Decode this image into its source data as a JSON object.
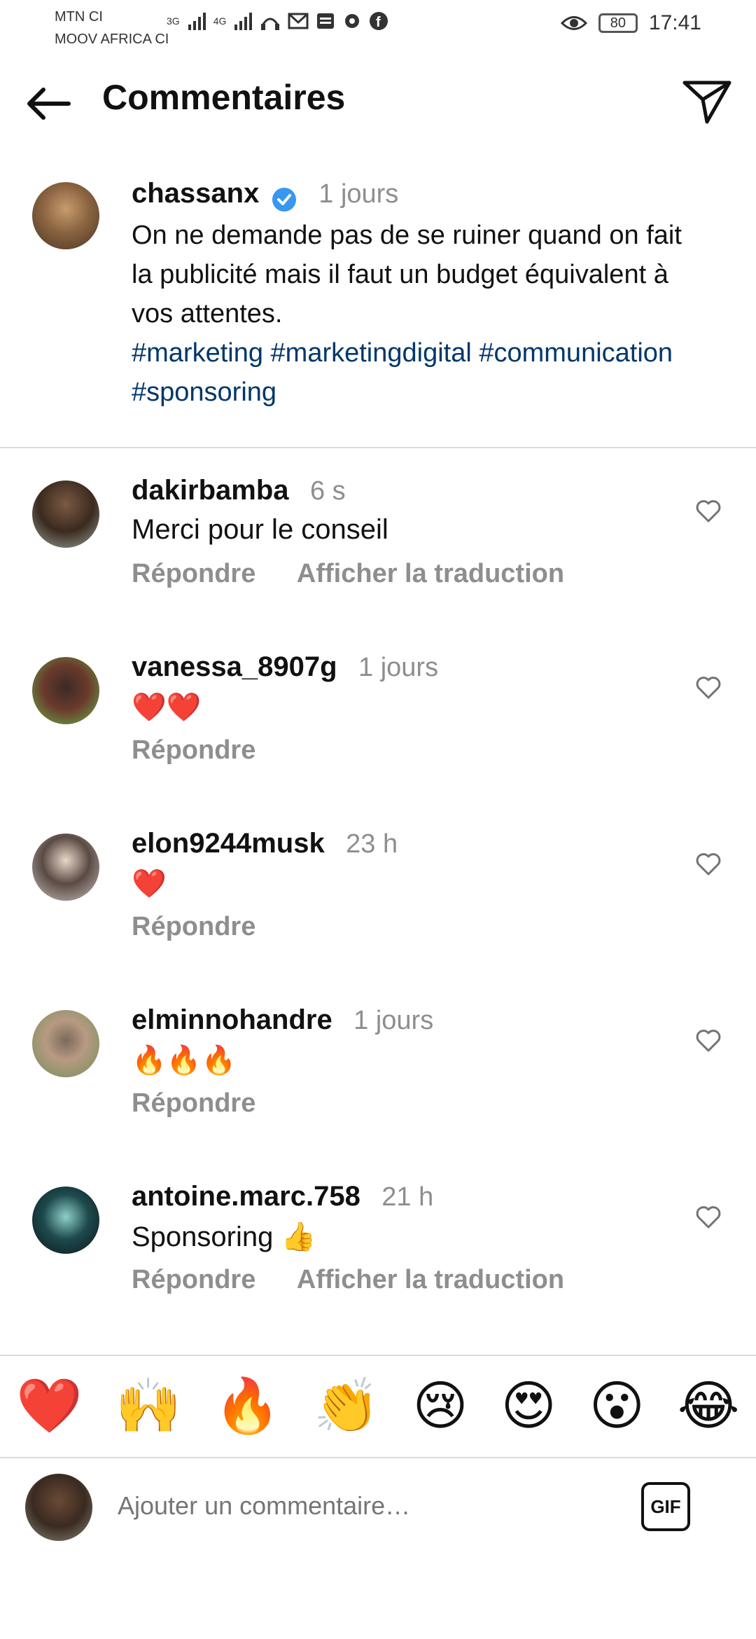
{
  "status_bar": {
    "carrier1": "MTN CI",
    "carrier2": "MOOV AFRICA CI",
    "network1": "3G",
    "network2": "4G",
    "battery": "80",
    "time": "17:41"
  },
  "header": {
    "title": "Commentaires",
    "back_icon": "arrow-left",
    "send_icon": "paper-plane"
  },
  "caption": {
    "username": "chassanx",
    "time": "1 jours",
    "verified": true,
    "text": "On ne demande pas de se ruiner quand on fait la publicité mais il faut un budget équivalent à vos attentes.",
    "hashtags": "#marketing #marketingdigital #communication #sponsoring"
  },
  "comments": [
    {
      "username": "dakirbamba",
      "time": "6 s",
      "text": "Merci pour le conseil",
      "reply": "Répondre",
      "translate": "Afficher la traduction"
    },
    {
      "username": "vanessa_8907g",
      "time": "1 jours",
      "text": "❤️❤️",
      "reply": "Répondre"
    },
    {
      "username": "elon9244musk",
      "time": "23 h",
      "text": "❤️",
      "reply": "Répondre"
    },
    {
      "username": "elminnohandre",
      "time": "1 jours",
      "text": "🔥🔥🔥",
      "reply": "Répondre"
    },
    {
      "username": "antoine.marc.758",
      "time": "21 h",
      "text": "Sponsoring 👍",
      "reply": "Répondre",
      "translate": "Afficher la traduction"
    }
  ],
  "reactions": [
    "❤️",
    "🙌",
    "🔥",
    "👏",
    "😢",
    "😍",
    "😮",
    "😂"
  ],
  "input": {
    "placeholder": "Ajouter un commentaire…",
    "gif_label": "GIF"
  },
  "colors": {
    "hashtag": "#00376b",
    "muted": "#8e8e8e",
    "verified": "#3897f0",
    "divider": "#dbdbdb"
  }
}
